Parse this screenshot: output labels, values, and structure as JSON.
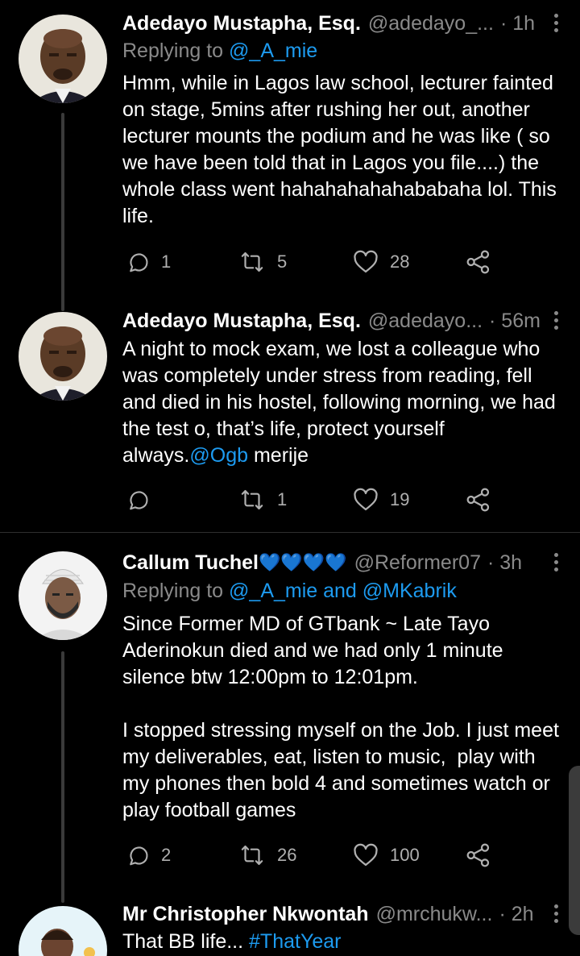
{
  "tweets": [
    {
      "name": "Adedayo Mustapha, Esq.",
      "handle": "@adedayo_...",
      "time": "· 1h",
      "replying_label": "Replying to ",
      "replying_to": "@_A_mie",
      "text": "Hmm, while in Lagos law school, lecturer fainted on stage, 5mins after rushing her out, another lecturer mounts the podium and he was like ( so we have been told that in Lagos you file....) the whole class went hahahahahahababaha lol. This life.",
      "replies": "1",
      "retweets": "5",
      "likes": "28"
    },
    {
      "name": "Adedayo Mustapha, Esq.",
      "handle": "@adedayo...",
      "time": "· 56m",
      "text_before": "A night to mock exam, we lost a colleague who was completely under stress from reading, fell and died in his hostel, following morning, we had the test o, that’s life, protect yourself always.",
      "text_mention": "@Ogb",
      "text_after": " merije",
      "replies": "",
      "retweets": "1",
      "likes": "19"
    },
    {
      "name": "Callum Tuchel",
      "hearts": "💙💙💙💙",
      "handle": "@Reformer07",
      "time": "· 3h",
      "replying_label": "Replying to ",
      "replying_to": "@_A_mie and @MKabrik",
      "text": "Since Former MD of GTbank ~ Late Tayo Aderinokun died and we had only 1 minute silence btw 12:00pm to 12:01pm.\n\nI stopped stressing myself on the Job. I just meet my deliverables, eat, listen to music,  play with my phones then bold 4 and sometimes watch or play football games",
      "replies": "2",
      "retweets": "26",
      "likes": "100"
    },
    {
      "name": "Mr Christopher Nkwontah",
      "handle": "@mrchukw...",
      "time": "· 2h",
      "text_before": "That BB life... ",
      "text_mention": "#ThatYear"
    }
  ],
  "icons": {
    "reply": "reply-icon",
    "retweet": "retweet-icon",
    "like": "heart-icon",
    "share": "share-icon",
    "more": "more-vertical-icon"
  },
  "colors": {
    "link": "#1d9bf0",
    "muted": "#8a8a8a",
    "background": "#000000"
  }
}
